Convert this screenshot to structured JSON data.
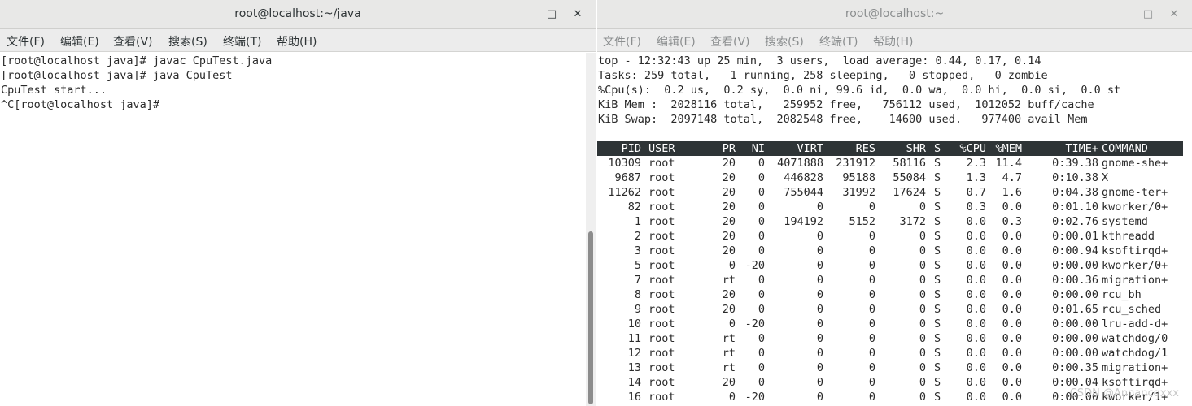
{
  "left_window": {
    "title": "root@localhost:~/java",
    "buttons": {
      "minimize": "_",
      "maximize": "□",
      "close": "✕"
    },
    "menu": [
      "文件(F)",
      "编辑(E)",
      "查看(V)",
      "搜索(S)",
      "终端(T)",
      "帮助(H)"
    ],
    "lines": [
      "[root@localhost java]# javac CpuTest.java",
      "[root@localhost java]# java CpuTest",
      "CpuTest start...",
      "^C[root@localhost java]# "
    ]
  },
  "right_window": {
    "title": "root@localhost:~",
    "buttons": {
      "minimize": "_",
      "maximize": "□",
      "close": "✕"
    },
    "menu": [
      "文件(F)",
      "编辑(E)",
      "查看(V)",
      "搜索(S)",
      "终端(T)",
      "帮助(H)"
    ],
    "summary": [
      "top - 12:32:43 up 25 min,  3 users,  load average: 0.44, 0.17, 0.14",
      "Tasks: 259 total,   1 running, 258 sleeping,   0 stopped,   0 zombie",
      "%Cpu(s):  0.2 us,  0.2 sy,  0.0 ni, 99.6 id,  0.0 wa,  0.0 hi,  0.0 si,  0.0 st",
      "KiB Mem :  2028116 total,   259952 free,   756112 used,  1012052 buff/cache",
      "KiB Swap:  2097148 total,  2082548 free,    14600 used.   977400 avail Mem"
    ],
    "columns": [
      "PID",
      "USER",
      "PR",
      "NI",
      "VIRT",
      "RES",
      "SHR",
      "S",
      "%CPU",
      "%MEM",
      "TIME+",
      "COMMAND"
    ],
    "processes": [
      [
        "10309",
        "root",
        "20",
        "0",
        "4071888",
        "231912",
        "58116",
        "S",
        "2.3",
        "11.4",
        "0:39.38",
        "gnome-she+"
      ],
      [
        "9687",
        "root",
        "20",
        "0",
        "446828",
        "95188",
        "55084",
        "S",
        "1.3",
        "4.7",
        "0:10.38",
        "X"
      ],
      [
        "11262",
        "root",
        "20",
        "0",
        "755044",
        "31992",
        "17624",
        "S",
        "0.7",
        "1.6",
        "0:04.38",
        "gnome-ter+"
      ],
      [
        "82",
        "root",
        "20",
        "0",
        "0",
        "0",
        "0",
        "S",
        "0.3",
        "0.0",
        "0:01.10",
        "kworker/0+"
      ],
      [
        "1",
        "root",
        "20",
        "0",
        "194192",
        "5152",
        "3172",
        "S",
        "0.0",
        "0.3",
        "0:02.76",
        "systemd"
      ],
      [
        "2",
        "root",
        "20",
        "0",
        "0",
        "0",
        "0",
        "S",
        "0.0",
        "0.0",
        "0:00.01",
        "kthreadd"
      ],
      [
        "3",
        "root",
        "20",
        "0",
        "0",
        "0",
        "0",
        "S",
        "0.0",
        "0.0",
        "0:00.94",
        "ksoftirqd+"
      ],
      [
        "5",
        "root",
        "0",
        "-20",
        "0",
        "0",
        "0",
        "S",
        "0.0",
        "0.0",
        "0:00.00",
        "kworker/0+"
      ],
      [
        "7",
        "root",
        "rt",
        "0",
        "0",
        "0",
        "0",
        "S",
        "0.0",
        "0.0",
        "0:00.36",
        "migration+"
      ],
      [
        "8",
        "root",
        "20",
        "0",
        "0",
        "0",
        "0",
        "S",
        "0.0",
        "0.0",
        "0:00.00",
        "rcu_bh"
      ],
      [
        "9",
        "root",
        "20",
        "0",
        "0",
        "0",
        "0",
        "S",
        "0.0",
        "0.0",
        "0:01.65",
        "rcu_sched"
      ],
      [
        "10",
        "root",
        "0",
        "-20",
        "0",
        "0",
        "0",
        "S",
        "0.0",
        "0.0",
        "0:00.00",
        "lru-add-d+"
      ],
      [
        "11",
        "root",
        "rt",
        "0",
        "0",
        "0",
        "0",
        "S",
        "0.0",
        "0.0",
        "0:00.00",
        "watchdog/0"
      ],
      [
        "12",
        "root",
        "rt",
        "0",
        "0",
        "0",
        "0",
        "S",
        "0.0",
        "0.0",
        "0:00.00",
        "watchdog/1"
      ],
      [
        "13",
        "root",
        "rt",
        "0",
        "0",
        "0",
        "0",
        "S",
        "0.0",
        "0.0",
        "0:00.35",
        "migration+"
      ],
      [
        "14",
        "root",
        "20",
        "0",
        "0",
        "0",
        "0",
        "S",
        "0.0",
        "0.0",
        "0:00.04",
        "ksoftirqd+"
      ],
      [
        "16",
        "root",
        "0",
        "-20",
        "0",
        "0",
        "0",
        "S",
        "0.0",
        "0.0",
        "0:00.00",
        "kworker/1+"
      ]
    ]
  },
  "watermark": "CSDN @Annancqxxx"
}
